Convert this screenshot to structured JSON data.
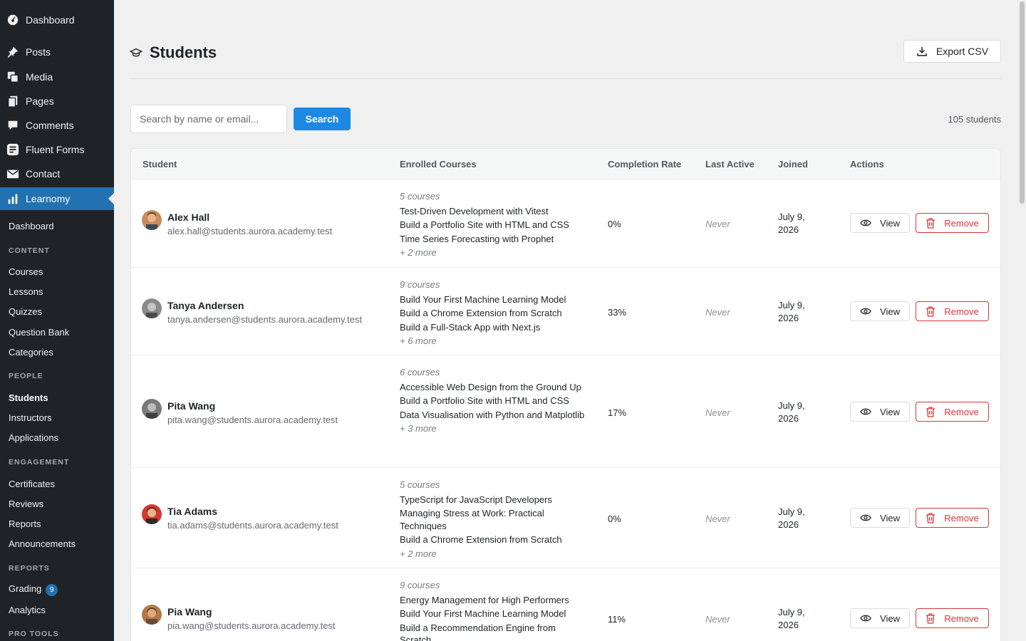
{
  "sidebar": {
    "menu": [
      {
        "label": "Dashboard",
        "icon": "dashboard-icon"
      },
      {
        "label": "Posts",
        "icon": "pin-icon"
      },
      {
        "label": "Media",
        "icon": "media-icon"
      },
      {
        "label": "Pages",
        "icon": "pages-icon"
      },
      {
        "label": "Comments",
        "icon": "comment-icon"
      },
      {
        "label": "Fluent Forms",
        "icon": "forms-icon"
      },
      {
        "label": "Contact",
        "icon": "mail-icon"
      },
      {
        "label": "Learnomy",
        "icon": "bar-chart-icon"
      }
    ],
    "sub": {
      "dashboard": "Dashboard",
      "content_head": "CONTENT",
      "courses": "Courses",
      "lessons": "Lessons",
      "quizzes": "Quizzes",
      "question_bank": "Question Bank",
      "categories": "Categories",
      "people_head": "PEOPLE",
      "students": "Students",
      "instructors": "Instructors",
      "applications": "Applications",
      "engagement_head": "ENGAGEMENT",
      "certificates": "Certificates",
      "reviews": "Reviews",
      "reports": "Reports",
      "announcements": "Announcements",
      "reports_head": "REPORTS",
      "grading": "Grading",
      "grading_badge": "9",
      "analytics": "Analytics",
      "pro_tools_head": "PRO TOOLS"
    }
  },
  "header": {
    "title": "Students",
    "export_label": "Export CSV"
  },
  "search": {
    "placeholder": "Search by name or email...",
    "button_label": "Search",
    "count": "105 students"
  },
  "table": {
    "columns": [
      "Student",
      "Enrolled Courses",
      "Completion Rate",
      "Last Active",
      "Joined",
      "Actions"
    ],
    "view_label": "View",
    "remove_label": "Remove",
    "rows": [
      {
        "name": "Alex Hall",
        "email": "alex.hall@students.aurora.academy.test",
        "course_count": "5 courses",
        "courses": [
          "Test-Driven Development with Vitest",
          "Build a Portfolio Site with HTML and CSS",
          "Time Series Forecasting with Prophet"
        ],
        "more": "+ 2 more",
        "rate": "0%",
        "last_active": "Never",
        "joined_1": "July 9,",
        "joined_2": "2026"
      },
      {
        "name": "Tanya Andersen",
        "email": "tanya.andersen@students.aurora.academy.test",
        "course_count": "9 courses",
        "courses": [
          "Build Your First Machine Learning Model",
          "Build a Chrome Extension from Scratch",
          "Build a Full-Stack App with Next.js"
        ],
        "more": "+ 6 more",
        "rate": "33%",
        "last_active": "Never",
        "joined_1": "July 9,",
        "joined_2": "2026"
      },
      {
        "name": "Pita Wang",
        "email": "pita.wang@students.aurora.academy.test",
        "course_count": "6 courses",
        "courses": [
          "Accessible Web Design from the Ground Up",
          "Build a Portfolio Site with HTML and CSS",
          "Data Visualisation with Python and Matplotlib"
        ],
        "more": "+ 3 more",
        "rate": "17%",
        "last_active": "Never",
        "joined_1": "July 9,",
        "joined_2": "2026"
      },
      {
        "name": "Tia Adams",
        "email": "tia.adams@students.aurora.academy.test",
        "course_count": "5 courses",
        "courses": [
          "TypeScript for JavaScript Developers",
          "Managing Stress at Work: Practical Techniques",
          "Build a Chrome Extension from Scratch"
        ],
        "more": "+ 2 more",
        "rate": "0%",
        "last_active": "Never",
        "joined_1": "July 9,",
        "joined_2": "2026"
      },
      {
        "name": "Pia Wang",
        "email": "pia.wang@students.aurora.academy.test",
        "course_count": "9 courses",
        "courses": [
          "Energy Management for High Performers",
          "Build Your First Machine Learning Model",
          "Build a Recommendation Engine from Scratch"
        ],
        "more": "",
        "rate": "11%",
        "last_active": "Never",
        "joined_1": "July 9,",
        "joined_2": "2026"
      }
    ]
  },
  "colors": {
    "sidebar_bg": "#1d2327",
    "accent": "#2271b1",
    "danger": "#d63638"
  }
}
